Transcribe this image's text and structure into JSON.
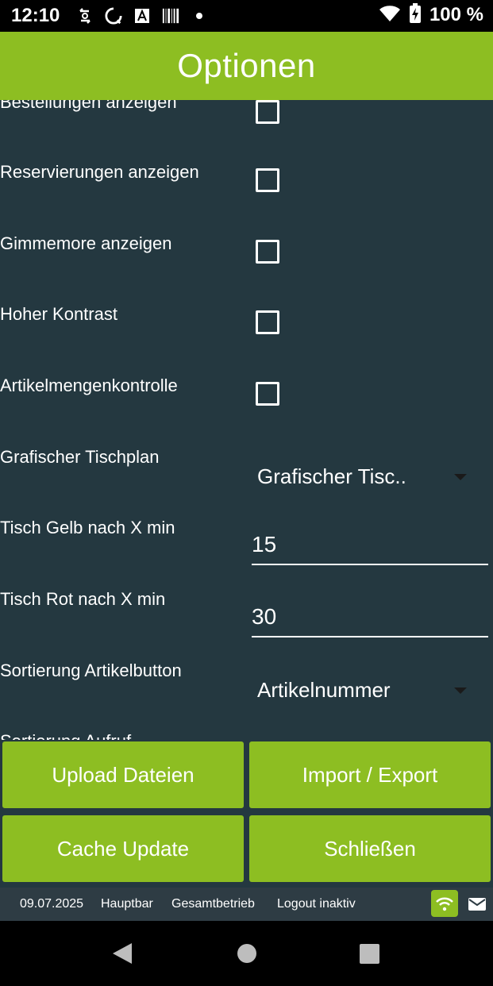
{
  "status_bar": {
    "time": "12:10",
    "battery": "100 %",
    "icons": [
      "sync-icon",
      "loading-icon",
      "app-a-icon",
      "barcode-icon",
      "dot-icon",
      "wifi-icon",
      "battery-charging-icon"
    ]
  },
  "header": {
    "title": "Optionen"
  },
  "options": {
    "bestellungen": {
      "label": "Bestellungen anzeigen",
      "checked": false
    },
    "reservierungen": {
      "label": "Reservierungen anzeigen",
      "checked": false
    },
    "gimmemore": {
      "label": "Gimmemore anzeigen",
      "checked": false
    },
    "kontrast": {
      "label": "Hoher Kontrast",
      "checked": false
    },
    "artikelmengen": {
      "label": "Artikelmengenkontrolle",
      "checked": false
    },
    "tischplan": {
      "label": "Grafischer Tischplan",
      "value": "Grafischer Tisc.."
    },
    "tisch_gelb": {
      "label": "Tisch Gelb nach X min",
      "value": "15"
    },
    "tisch_rot": {
      "label": "Tisch Rot nach X min",
      "value": "30"
    },
    "sortierung_artikel": {
      "label": "Sortierung Artikelbutton",
      "value": "Artikelnummer"
    },
    "sortierung_cut": {
      "label": "Sortierung Aufruf..."
    }
  },
  "buttons": {
    "upload": "Upload Dateien",
    "import_export": "Import / Export",
    "cache_update": "Cache Update",
    "close": "Schließen"
  },
  "footer": {
    "date": "09.07.2025",
    "location": "Hauptbar",
    "mode": "Gesamtbetrieb",
    "logout": "Logout inaktiv"
  },
  "colors": {
    "accent": "#8dbe22",
    "content_bg": "#243840",
    "footer_bg": "#2e3c44"
  }
}
